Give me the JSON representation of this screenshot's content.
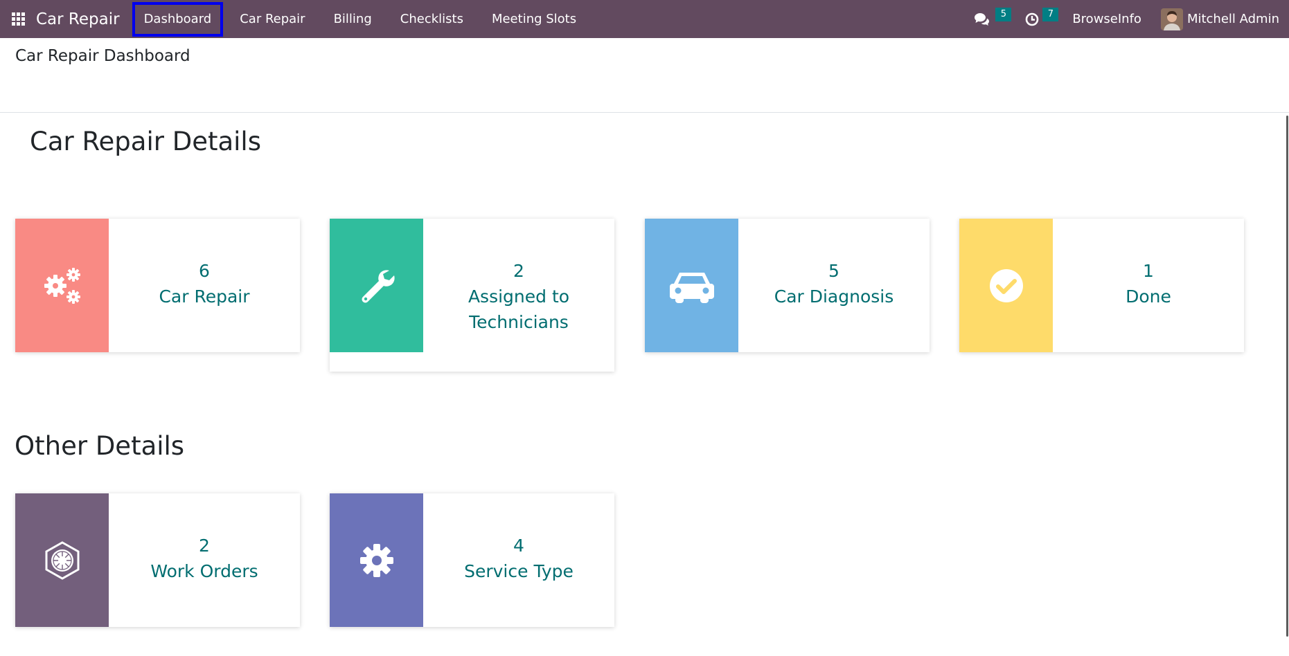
{
  "navbar": {
    "brand": "Car Repair",
    "menu": [
      {
        "label": "Dashboard",
        "active": true
      },
      {
        "label": "Car Repair"
      },
      {
        "label": "Billing"
      },
      {
        "label": "Checklists"
      },
      {
        "label": "Meeting Slots"
      }
    ],
    "messages_count": "5",
    "activities_count": "7",
    "company": "BrowseInfo",
    "user": "Mitchell Admin"
  },
  "page": {
    "title": "Car Repair Dashboard"
  },
  "sections": {
    "details_heading": "Car Repair Details",
    "other_heading": "Other Details"
  },
  "tiles": [
    {
      "count": "6",
      "label": "Car Repair",
      "icon": "gears-icon",
      "color": "#f98a84"
    },
    {
      "count": "2",
      "label": "Assigned to Technicians",
      "icon": "wrench-icon",
      "color": "#30bd9d"
    },
    {
      "count": "5",
      "label": "Car Diagnosis",
      "icon": "car-icon",
      "color": "#70b3e4"
    },
    {
      "count": "1",
      "label": "Done",
      "icon": "check-circle-icon",
      "color": "#fedb6a"
    },
    {
      "count": "2",
      "label": "Work Orders",
      "icon": "empire-icon",
      "color": "#735f7c"
    },
    {
      "count": "4",
      "label": "Service Type",
      "icon": "cog-icon",
      "color": "#6c73b9"
    }
  ],
  "colors": {
    "navbar": "#624a5f",
    "badge": "#017e84",
    "tile_text": "#016d70",
    "active_outline": "#0000ee"
  }
}
